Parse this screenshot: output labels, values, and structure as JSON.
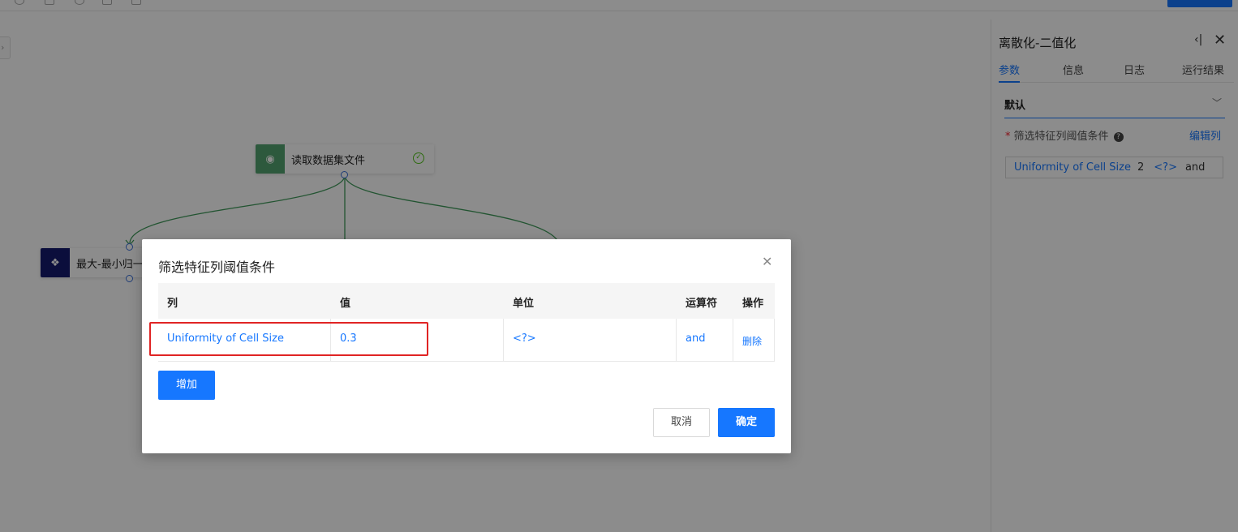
{
  "toolbar": {
    "icons": [
      "undo-icon",
      "save-icon",
      "refresh-icon",
      "copy-icon",
      "paste-icon"
    ]
  },
  "canvas": {
    "nodes": [
      {
        "label": "读取数据集文件",
        "icon": "dataset-icon",
        "status": "success",
        "color": "#52a36f"
      },
      {
        "label": "最大-最小归一",
        "icon": "diamond-grid-icon",
        "color": "#151a6e"
      }
    ],
    "edge_color": "#3f9a5a"
  },
  "panel": {
    "title": "离散化-二值化",
    "tabs": [
      {
        "label": "参数",
        "active": true
      },
      {
        "label": "信息",
        "active": false
      },
      {
        "label": "日志",
        "active": false
      },
      {
        "label": "运行结果",
        "active": false
      }
    ],
    "section_title": "默认",
    "field_label": "筛选特征列阈值条件",
    "edit_columns_label": "编辑列",
    "condition": {
      "column": "Uniformity of Cell Size",
      "value": "2",
      "unit": "<?>",
      "operator": "and"
    }
  },
  "modal": {
    "title": "筛选特征列阈值条件",
    "columns": [
      "列",
      "值",
      "单位",
      "运算符",
      "操作"
    ],
    "rows": [
      {
        "column": "Uniformity of Cell Size",
        "value": "0.3",
        "unit": "<?>",
        "operator": "and",
        "action": "删除"
      }
    ],
    "add_label": "增加",
    "cancel_label": "取消",
    "confirm_label": "确定"
  },
  "colors": {
    "accent": "#1677ff",
    "highlight": "#e02424"
  }
}
